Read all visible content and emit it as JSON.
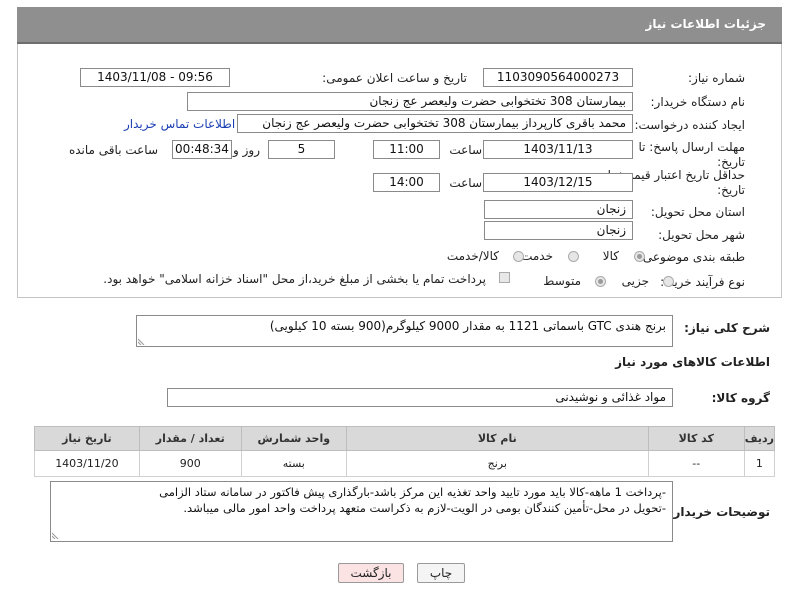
{
  "header": {
    "title": "جزئیات اطلاعات نیاز"
  },
  "form": {
    "need_number_label": "شماره نیاز:",
    "need_number": "1103090564000273",
    "announce_label": "تاریخ و ساعت اعلان عمومی:",
    "announce_value": "1403/11/08 - 09:56",
    "buyer_org_label": "نام دستگاه خریدار:",
    "buyer_org": "بیمارستان 308 تختخوابی حضرت ولیعصر عج  زنجان",
    "requester_label": "ایجاد کننده درخواست:",
    "requester": "محمد باقری کارپرداز بیمارستان 308 تختخوابی حضرت ولیعصر عج  زنجان",
    "contact_link": "اطلاعات تماس خریدار",
    "deadline_label_1": "مهلت ارسال پاسخ: تا",
    "deadline_label_2": "تاریخ:",
    "deadline_date": "1403/11/13",
    "time_label": "ساعت",
    "deadline_time": "11:00",
    "days_value": "5",
    "days_label": "روز و",
    "remaining_time": "00:48:34",
    "remaining_label": "ساعت باقی مانده",
    "validity_label_1": "حداقل تاریخ اعتبار قیمت: تا",
    "validity_label_2": "تاریخ:",
    "validity_date": "1403/12/15",
    "validity_time": "14:00",
    "province_label": "استان محل تحویل:",
    "province": "زنجان",
    "city_label": "شهر محل تحویل:",
    "city": "زنجان",
    "category_label": "طبقه بندی موضوعی:",
    "category_options": [
      "کالا",
      "خدمت",
      "کالا/خدمت"
    ],
    "category_selected": "کالا",
    "process_label": "نوع فرآیند خرید :",
    "process_options": [
      "جزیی",
      "متوسط"
    ],
    "payment_note": "پرداخت تمام یا بخشی از مبلغ خرید،از محل \"اسناد خزانه اسلامی\" خواهد بود."
  },
  "description": {
    "label": "شرح کلی نیاز:",
    "value": "برنج هندی GTC باسماتی 1121 به مقدار 9000 کیلوگرم(900 بسته 10 کیلویی)"
  },
  "goods": {
    "section_title": "اطلاعات کالاهای مورد نیاز",
    "group_label": "گروه کالا:",
    "group_value": "مواد غذائی و نوشیدنی",
    "columns": [
      "ردیف",
      "کد کالا",
      "نام کالا",
      "واحد شمارش",
      "تعداد / مقدار",
      "تاریخ نیاز"
    ],
    "rows": [
      [
        "1",
        "--",
        "برنج",
        "بسته",
        "900",
        "1403/11/20"
      ]
    ]
  },
  "buyer_notes": {
    "label": "توضیحات خریدار:",
    "line1": "-پرداخت 1 ماهه-کالا باید مورد تایید واحد تغذیه این مرکز باشد-بارگذاری پیش فاکتور در سامانه ستاد الزامی",
    "line2": "-تحویل در محل-تأمین کنندگان بومی در الویت-لازم به ذکراست متعهد پرداخت واحد امور مالی میباشد."
  },
  "buttons": {
    "print": "چاپ",
    "back": "بازگشت"
  },
  "colors": {
    "header_bg": "#8f8f8f",
    "link": "#1a3fb3",
    "back_button_bg": "#fbe3e3"
  }
}
